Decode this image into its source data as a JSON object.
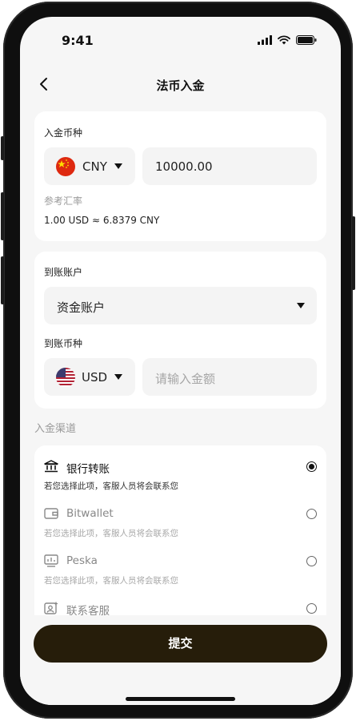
{
  "status_bar": {
    "time": "9:41"
  },
  "nav": {
    "title": "法币入金"
  },
  "deposit": {
    "label": "入金币种",
    "currency": "CNY",
    "amount": "10000.00",
    "rate_label": "参考汇率",
    "rate_value": "1.00 USD ≈ 6.8379 CNY"
  },
  "receive": {
    "account_label": "到账账户",
    "account_value": "资金账户",
    "currency_label": "到账币种",
    "currency": "USD",
    "amount_placeholder": "请输入金额"
  },
  "channels": {
    "label": "入金渠道",
    "items": [
      {
        "name": "银行转账",
        "desc": "若您选择此项，客服人员将会联系您",
        "selected": true,
        "icon": "bank-icon"
      },
      {
        "name": "Bitwallet",
        "desc": "若您选择此项，客服人员将会联系您",
        "selected": false,
        "icon": "wallet-icon"
      },
      {
        "name": "Peska",
        "desc": "若您选择此项，客服人员将会联系您",
        "selected": false,
        "icon": "monitor-chart-icon"
      },
      {
        "name": "联系客服",
        "desc": "",
        "selected": false,
        "icon": "customer-service-icon"
      }
    ]
  },
  "submit_label": "提交",
  "colors": {
    "submit_bg": "#261d0a",
    "card_bg": "#ffffff",
    "screen_bg": "#f6f6f6",
    "muted": "#9a9a9a"
  }
}
